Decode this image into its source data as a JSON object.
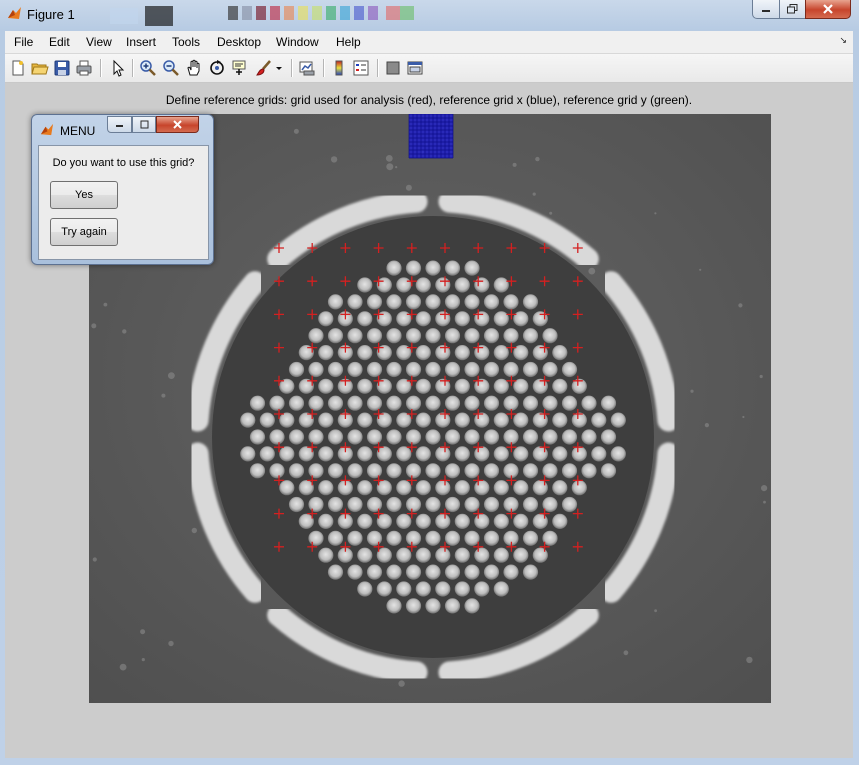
{
  "window": {
    "title": "Figure 1",
    "icon": "matlab-icon",
    "controls": [
      "minimize-icon",
      "maximize-icon",
      "close-icon"
    ]
  },
  "menubar": {
    "items": [
      "File",
      "Edit",
      "View",
      "Insert",
      "Tools",
      "Desktop",
      "Window",
      "Help"
    ]
  },
  "toolbar": {
    "tools": [
      "new-figure-icon",
      "open-file-icon",
      "save-icon",
      "print-icon",
      "edit-plot-arrow-icon",
      "zoom-in-icon",
      "zoom-out-icon",
      "pan-hand-icon",
      "rotate-3d-icon",
      "data-cursor-icon",
      "brush-icon",
      "brush-dropdown-icon",
      "link-plot-icon",
      "insert-colorbar-icon",
      "insert-legend-icon",
      "hide-plot-tools-icon",
      "show-plot-tools-icon"
    ]
  },
  "figure": {
    "caption": "Define reference grids: grid used for analysis (red), reference grid x (blue), reference grid y (green).",
    "image": "sem-micrograph-circular-pillar-array",
    "analysis_grid_color": "#d42020",
    "reference_grid_x_color": "#1a1ad8",
    "reference_grid_y_color": "#16a316"
  },
  "dialog": {
    "title": "MENU",
    "icon": "matlab-icon",
    "question": "Do you want to use this grid?",
    "yes_label": "Yes",
    "try_again_label": "Try again"
  }
}
